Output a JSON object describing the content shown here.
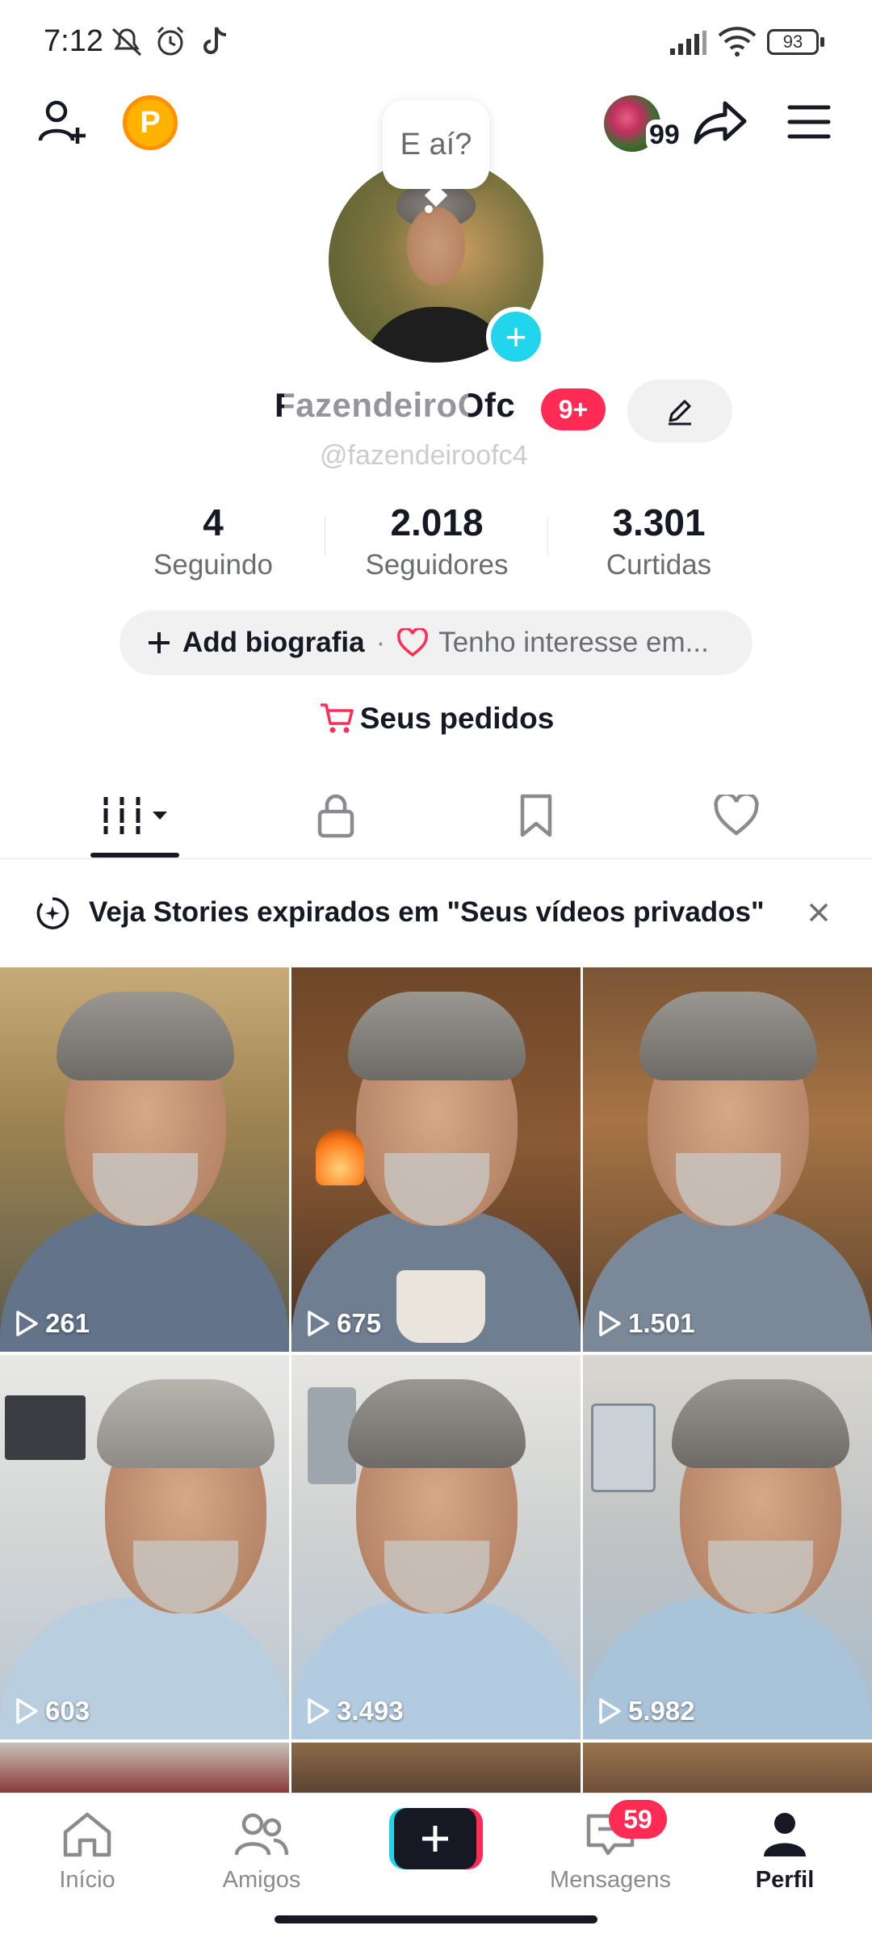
{
  "status_bar": {
    "time": "7:12",
    "battery": "93"
  },
  "topbar": {
    "points_label": "P",
    "notif_count": "99"
  },
  "profile": {
    "bubble_text": "E aí?",
    "username": "FazendeiroOfc",
    "notif_badge": "9+",
    "handle": "@fazendeiroofc4",
    "stats": [
      {
        "value": "4",
        "label": "Seguindo"
      },
      {
        "value": "2.018",
        "label": "Seguidores"
      },
      {
        "value": "3.301",
        "label": "Curtidas"
      }
    ],
    "bio_add": "Add biografia",
    "bio_dot": "·",
    "bio_interest": "Tenho interesse em..."
  },
  "orders_label": "Seus pedidos",
  "banner_text": "Veja Stories expirados em \"Seus vídeos privados\"",
  "videos": [
    {
      "views": "261"
    },
    {
      "views": "675"
    },
    {
      "views": "1.501"
    },
    {
      "views": "603"
    },
    {
      "views": "3.493"
    },
    {
      "views": "5.982"
    }
  ],
  "bottom_nav": {
    "home": "Início",
    "friends": "Amigos",
    "messages": "Mensagens",
    "messages_badge": "59",
    "profile": "Perfil"
  },
  "colors": {
    "accent_red": "#fe2c55",
    "accent_cyan": "#20d5ec",
    "text_dark": "#161823",
    "text_grey": "#6c6d72"
  }
}
